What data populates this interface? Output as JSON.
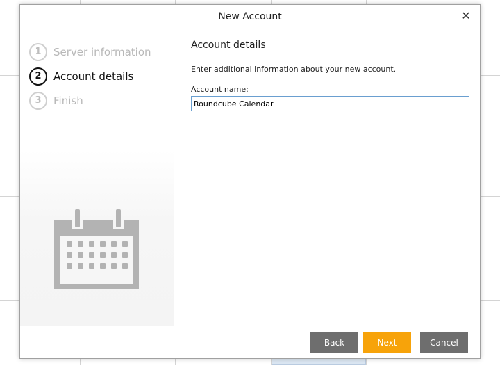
{
  "dialog": {
    "title": "New Account",
    "close_icon": "close-icon"
  },
  "steps": [
    {
      "number": "1",
      "label": "Server information",
      "state": "inactive"
    },
    {
      "number": "2",
      "label": "Account details",
      "state": "active"
    },
    {
      "number": "3",
      "label": "Finish",
      "state": "inactive"
    }
  ],
  "illustration": {
    "icon": "calendar-icon"
  },
  "content": {
    "section_title": "Account details",
    "description": "Enter additional information about your new account.",
    "account_name_label": "Account name:",
    "account_name_value": "Roundcube Calendar"
  },
  "buttons": {
    "back": "Back",
    "next": "Next",
    "cancel": "Cancel"
  },
  "colors": {
    "accent": "#f7a30a",
    "button_gray": "#6e6e6e",
    "input_border": "#6a9fd0"
  }
}
